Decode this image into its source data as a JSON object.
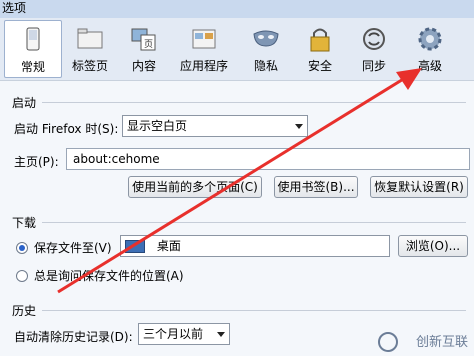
{
  "window": {
    "title": "选项"
  },
  "tabs": [
    {
      "label": "常规",
      "icon": "switch-icon"
    },
    {
      "label": "标签页",
      "icon": "folder-tabs-icon"
    },
    {
      "label": "内容",
      "icon": "content-icon"
    },
    {
      "label": "应用程序",
      "icon": "applications-icon"
    },
    {
      "label": "隐私",
      "icon": "mask-icon"
    },
    {
      "label": "安全",
      "icon": "padlock-icon"
    },
    {
      "label": "同步",
      "icon": "sync-icon"
    },
    {
      "label": "高级",
      "icon": "gear-icon"
    }
  ],
  "startup": {
    "heading": "启动",
    "when_label": "启动 Firefox 时(S):",
    "when_value": "显示空白页",
    "home_label": "主页(P):",
    "home_value": "about:cehome",
    "btn_current": "使用当前的多个页面(C)",
    "btn_bookmark": "使用书签(B)...",
    "btn_restore": "恢复默认设置(R)"
  },
  "downloads": {
    "heading": "下载",
    "save_to_label": "保存文件至(V)",
    "save_to_value": "桌面",
    "browse_btn": "浏览(O)...",
    "ask_label": "总是询问保存文件的位置(A)"
  },
  "history": {
    "heading": "历史",
    "clear_label": "自动清除历史记录(D):",
    "clear_value": "三个月以前"
  },
  "watermark": "创新互联",
  "colors": {
    "arrow": "#e8302c",
    "accent": "#2a62c9"
  }
}
